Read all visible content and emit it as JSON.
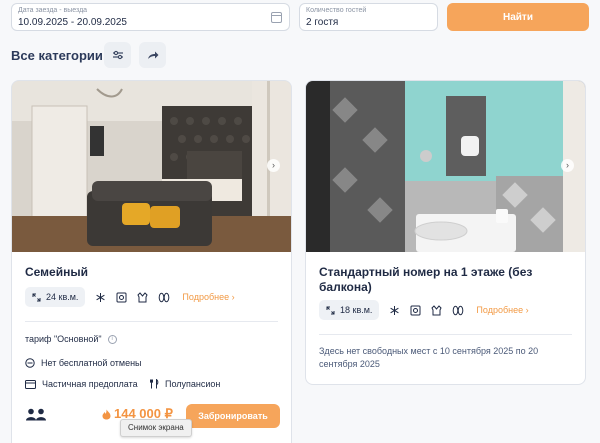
{
  "search": {
    "dates_label": "Дата заезда - выезда",
    "dates_value": "10.09.2025 - 20.09.2025",
    "guests_label": "Количество гостей",
    "guests_value": "2 гостя",
    "find_button": "Найти"
  },
  "categories": {
    "title": "Все категории",
    "filter_icon": "sliders-icon",
    "share_icon": "share-arrow-icon"
  },
  "rooms": [
    {
      "name": "Семейный",
      "area": "24 кв.м.",
      "amenities": [
        "snowflake-icon",
        "safe-icon",
        "bathrobe-icon",
        "slippers-icon"
      ],
      "more_link": "Подробнее",
      "tariff": "тариф \"Основной\"",
      "cancellation": "Нет бесплатной отмены",
      "payment": "Частичная предоплата",
      "meal": "Полупансион",
      "price": "144 000 ₽",
      "book_button": "Забронировать"
    },
    {
      "name": "Стандартный номер на 1 этаже (без балкона)",
      "area": "18 кв.м.",
      "amenities": [
        "snowflake-icon",
        "safe-icon",
        "bathrobe-icon",
        "slippers-icon"
      ],
      "more_link": "Подробнее",
      "availability": "Здесь нет свободных мест с 10 сентября 2025 по 20 сентября 2025"
    }
  ],
  "tooltip": "Снимок экрана",
  "colors": {
    "accent": "#f6a55b",
    "price": "#f39442",
    "text": "#1f2a44"
  }
}
